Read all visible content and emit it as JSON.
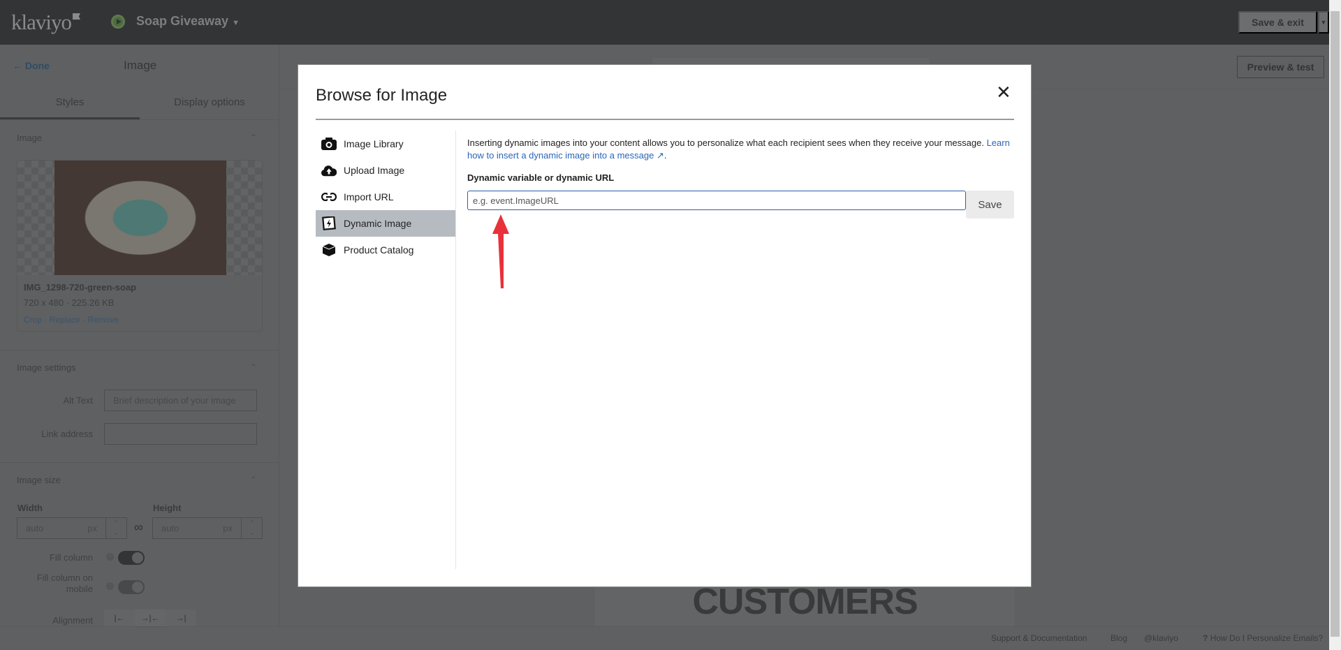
{
  "topbar": {
    "logo": "klaviyo",
    "campaign": "Soap Giveaway",
    "save_exit": "Save & exit",
    "status_color": "#5d7a4d"
  },
  "left_panel": {
    "done": "Done",
    "title": "Image",
    "tabs": [
      {
        "label": "Styles",
        "active": true
      },
      {
        "label": "Display options",
        "active": false
      }
    ],
    "image_section": {
      "title": "Image",
      "filename": "IMG_1298-720-green-soap",
      "dimensions": "720 x 480 · 225.26 KB",
      "links": [
        "Crop",
        "Replace",
        "Remove"
      ]
    },
    "image_settings": {
      "title": "Image settings",
      "alt_label": "Alt Text",
      "alt_placeholder": "Brief description of your image",
      "link_label": "Link address",
      "link_value": ""
    },
    "image_size": {
      "title": "Image size",
      "width_label": "Width",
      "height_label": "Height",
      "width_placeholder": "auto",
      "height_placeholder": "auto",
      "unit": "px",
      "fill_column": "Fill column",
      "fill_column_on": true,
      "fill_mobile": "Fill column on mobile",
      "fill_mobile_on": true,
      "alignment": "Alignment",
      "alignment_icons": [
        "align-left-icon",
        "align-center-icon",
        "align-right-icon"
      ]
    }
  },
  "toolbar": {
    "preview": "Preview & test"
  },
  "canvas": {
    "headline": "CUSTOMERS"
  },
  "footer": {
    "links": [
      "Support & Documentation",
      "Blog",
      "@klaviyo",
      "How Do I Personalize Emails?"
    ]
  },
  "modal": {
    "title": "Browse for Image",
    "nav": [
      {
        "label": "Image Library",
        "icon": "camera-icon",
        "active": false
      },
      {
        "label": "Upload Image",
        "icon": "cloud-upload-icon",
        "active": false
      },
      {
        "label": "Import URL",
        "icon": "link-icon",
        "active": false
      },
      {
        "label": "Dynamic Image",
        "icon": "dynamic-image-icon",
        "active": true
      },
      {
        "label": "Product Catalog",
        "icon": "box-icon",
        "active": false
      }
    ],
    "description": "Inserting dynamic images into your content allows you to personalize what each recipient sees when they receive your message.",
    "learn_link": "Learn how to insert a dynamic image into a message",
    "field_label": "Dynamic variable or dynamic URL",
    "field_placeholder": "e.g. event.ImageURL",
    "field_value": "",
    "save": "Save",
    "annotation_color": "#e8313a"
  }
}
